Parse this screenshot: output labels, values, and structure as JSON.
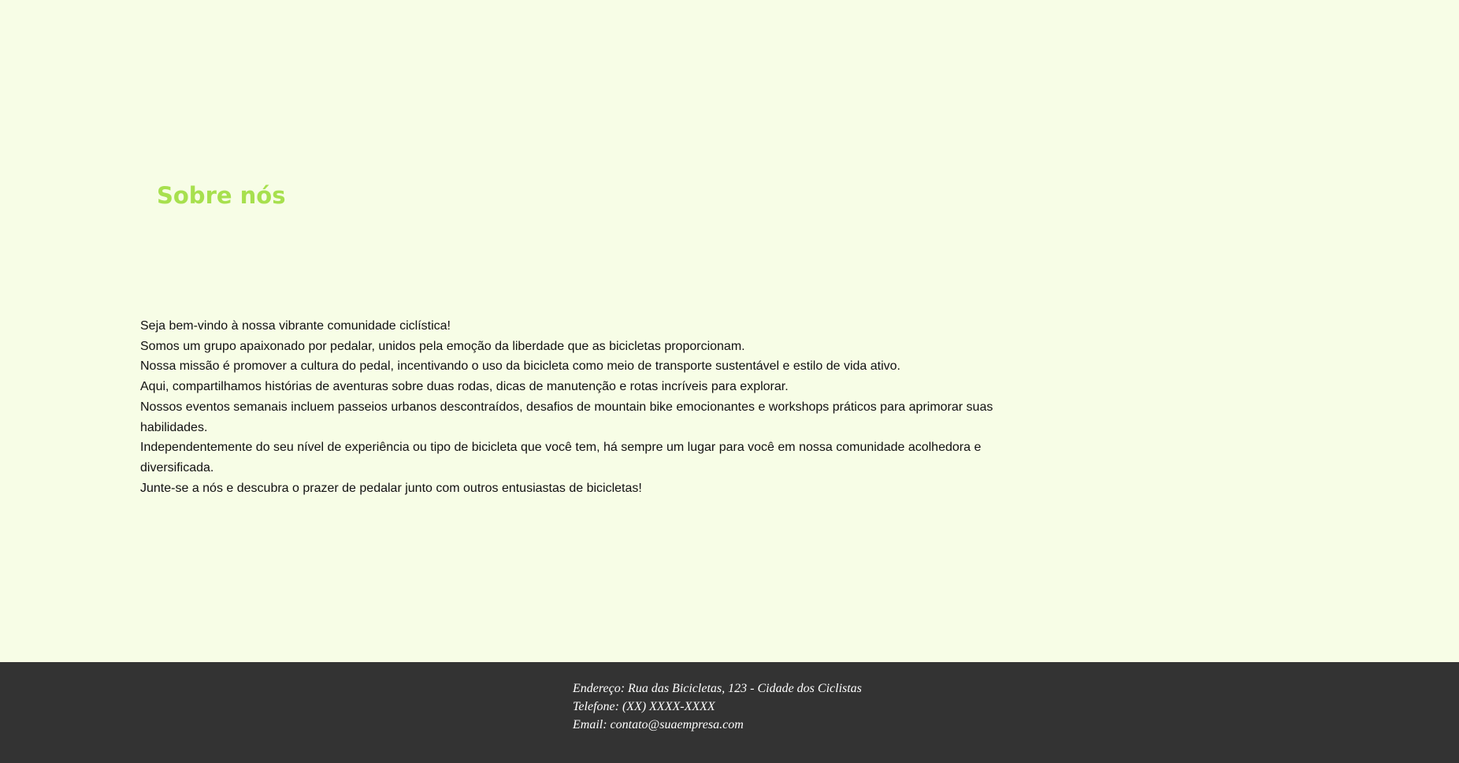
{
  "about": {
    "title": "Sobre nós",
    "paragraphs": [
      "Seja bem-vindo à nossa vibrante comunidade ciclística!",
      "Somos um grupo apaixonado por pedalar, unidos pela emoção da liberdade que as bicicletas proporcionam.",
      "Nossa missão é promover a cultura do pedal, incentivando o uso da bicicleta como meio de transporte sustentável e estilo de vida ativo.",
      "Aqui, compartilhamos histórias de aventuras sobre duas rodas, dicas de manutenção e rotas incríveis para explorar.",
      "Nossos eventos semanais incluem passeios urbanos descontraídos, desafios de mountain bike emocionantes e workshops práticos para aprimorar suas habilidades.",
      "Independentemente do seu nível de experiência ou tipo de bicicleta que você tem, há sempre um lugar para você em nossa comunidade acolhedora e diversificada.",
      "Junte-se a nós e descubra o prazer de pedalar junto com outros entusiastas de bicicletas!"
    ]
  },
  "footer": {
    "address": "Endereço: Rua das Bicicletas, 123 - Cidade dos Ciclistas",
    "phone": "Telefone: (XX) XXXX-XXXX",
    "email": "Email: contato@suaempresa.com"
  },
  "colors": {
    "page_background": "#f7fde6",
    "title_accent": "#a7e04e",
    "footer_background": "#333333",
    "body_text": "#111111",
    "footer_text": "#ffffff"
  }
}
